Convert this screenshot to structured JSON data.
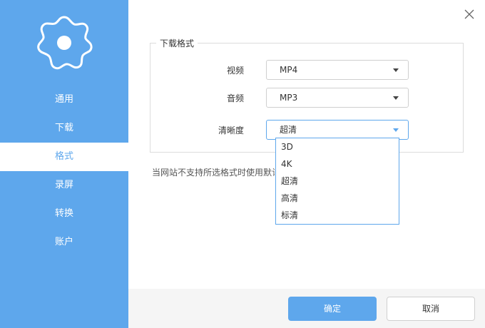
{
  "sidebar": {
    "items": [
      {
        "label": "通用"
      },
      {
        "label": "下载"
      },
      {
        "label": "格式"
      },
      {
        "label": "录屏"
      },
      {
        "label": "转换"
      },
      {
        "label": "账户"
      }
    ],
    "active": "格式"
  },
  "format_group": {
    "title": "下载格式",
    "video_label": "视频",
    "video_value": "MP4",
    "audio_label": "音频",
    "audio_value": "MP3",
    "quality_label": "清晰度",
    "quality_value": "超清",
    "quality_options": [
      "3D",
      "4K",
      "超清",
      "高清",
      "标清"
    ]
  },
  "note": "当网站不支持所选格式时使用默认",
  "footer": {
    "ok_label": "确定",
    "cancel_label": "取消"
  },
  "colors": {
    "accent": "#5ea7ec",
    "footer_bg": "#f5f5f5"
  },
  "icons": {
    "settings": "gear-icon",
    "close": "close-icon",
    "dropdown": "caret-down-icon"
  }
}
